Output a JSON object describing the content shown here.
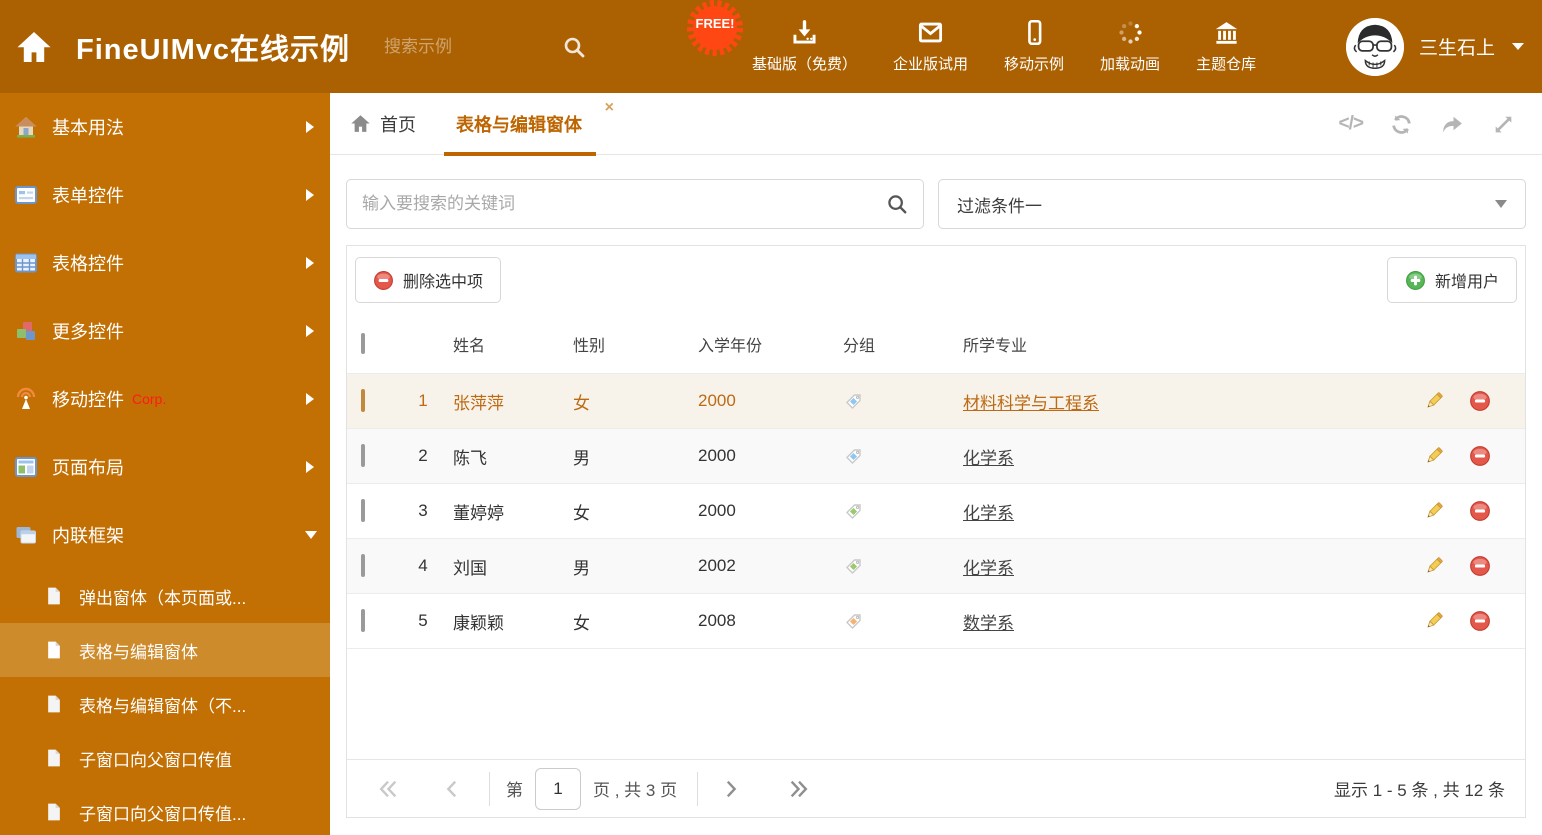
{
  "header": {
    "title": "FineUIMvc在线示例",
    "search_placeholder": "搜索示例",
    "free_badge": "FREE!",
    "nav": [
      {
        "label": "基础版（免费）",
        "icon": "download-icon"
      },
      {
        "label": "企业版试用",
        "icon": "envelope-icon"
      },
      {
        "label": "移动示例",
        "icon": "mobile-icon"
      },
      {
        "label": "加载动画",
        "icon": "spinner-icon"
      },
      {
        "label": "主题仓库",
        "icon": "bank-icon"
      }
    ],
    "user_name": "三生石上"
  },
  "sidebar": {
    "items": [
      {
        "label": "基本用法",
        "icon": "house-icon"
      },
      {
        "label": "表单控件",
        "icon": "form-icon"
      },
      {
        "label": "表格控件",
        "icon": "table-icon"
      },
      {
        "label": "更多控件",
        "icon": "cubes-icon"
      },
      {
        "label": "移动控件",
        "badge": "Corp.",
        "icon": "antenna-icon"
      },
      {
        "label": "页面布局",
        "icon": "layout-icon"
      },
      {
        "label": "内联框架",
        "icon": "frames-icon",
        "expanded": true
      }
    ],
    "subitems": [
      {
        "label": "弹出窗体（本页面或..."
      },
      {
        "label": "表格与编辑窗体",
        "active": true
      },
      {
        "label": "表格与编辑窗体（不..."
      },
      {
        "label": "子窗口向父窗口传值"
      },
      {
        "label": "子窗口向父窗口传值..."
      }
    ]
  },
  "tabs": {
    "home_label": "首页",
    "active_label": "表格与编辑窗体",
    "close_glyph": "×",
    "code_glyph": "</>"
  },
  "filter": {
    "search_placeholder": "输入要搜索的关键词",
    "value": "过滤条件一"
  },
  "toolbar": {
    "delete_label": "删除选中项",
    "add_label": "新增用户"
  },
  "table": {
    "columns": [
      "姓名",
      "性别",
      "入学年份",
      "分组",
      "所学专业"
    ],
    "rows": [
      {
        "num": "1",
        "name": "张萍萍",
        "gender": "女",
        "year": "2000",
        "tag": "blue",
        "major": "材料科学与工程系",
        "selected": true
      },
      {
        "num": "2",
        "name": "陈飞",
        "gender": "男",
        "year": "2000",
        "tag": "blue",
        "major": "化学系"
      },
      {
        "num": "3",
        "name": "董婷婷",
        "gender": "女",
        "year": "2000",
        "tag": "green",
        "major": "化学系"
      },
      {
        "num": "4",
        "name": "刘国",
        "gender": "男",
        "year": "2002",
        "tag": "green",
        "major": "化学系"
      },
      {
        "num": "5",
        "name": "康颖颖",
        "gender": "女",
        "year": "2008",
        "tag": "orange",
        "major": "数学系"
      }
    ]
  },
  "pager": {
    "prefix": "第",
    "page": "1",
    "suffix": "页 , 共 3 页",
    "summary": "显示 1 - 5 条 , 共 12 条"
  },
  "colors": {
    "accent": "#BD6500",
    "header_bg": "#AB6102",
    "sidebar_bg": "#C26F04",
    "sidebar_active_bg": "#CE8B2C",
    "free_badge": "#FF4713",
    "delete_red": "#E4574B",
    "add_green": "#58B558",
    "tag_blue": "#8CC8F2",
    "tag_green": "#9BCA6A",
    "tag_orange": "#F6B26E",
    "selected_row_bg": "#F7F3EA",
    "selected_row_text": "#BC6A14"
  }
}
